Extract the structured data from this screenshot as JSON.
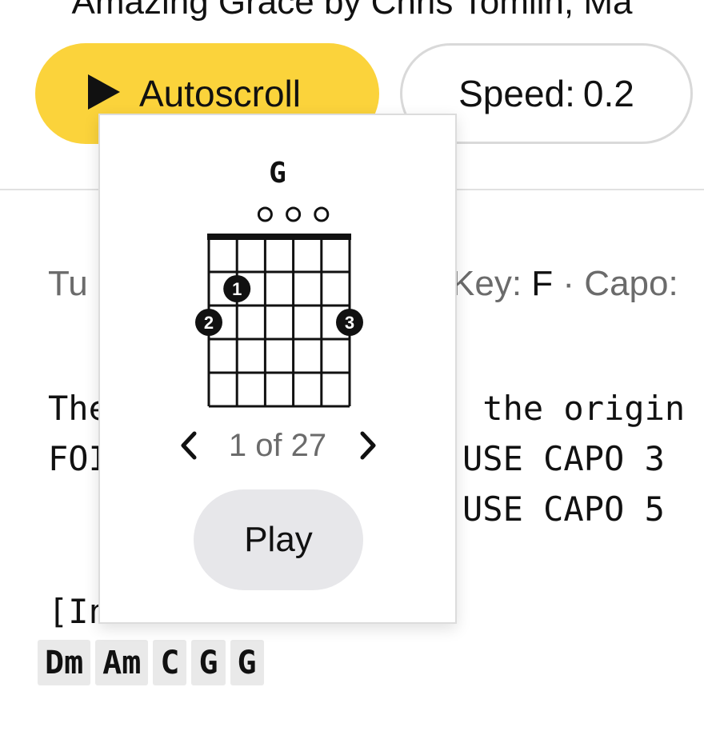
{
  "header": {
    "clipped_title": "Amazing Grace by Chris Tomlin, Ma"
  },
  "toolbar": {
    "autoscroll_label": "Autoscroll",
    "speed_label": "Speed:",
    "speed_value": "0.2"
  },
  "meta": {
    "tuning_prefix": "Tu",
    "key_label": "Key:",
    "key_value": "F",
    "separator": "·",
    "capo_label": "Capo:"
  },
  "tab_text": {
    "line1_left": "The",
    "line1_right": " the origin",
    "line2_left": "FOI",
    "line2_right": "USE CAPO 3",
    "line3_right": "USE CAPO 5",
    "section_label_visible": "[In"
  },
  "chords": [
    "Dm",
    "Am",
    "C",
    "G",
    "G"
  ],
  "chord_popup": {
    "name": "G",
    "open_strings": [
      3,
      4,
      5
    ],
    "fingers": [
      {
        "string": 1,
        "fret": 3,
        "finger": "2"
      },
      {
        "string": 2,
        "fret": 2,
        "finger": "1"
      },
      {
        "string": 6,
        "fret": 3,
        "finger": "3"
      }
    ],
    "pager_current": "1",
    "pager_of": "of",
    "pager_total": "27",
    "play_label": "Play"
  },
  "colors": {
    "accent": "#fbd33b",
    "chip_bg": "#e9e9e9",
    "play_bg": "#e7e7ea",
    "muted_text": "#6b6b6b"
  }
}
